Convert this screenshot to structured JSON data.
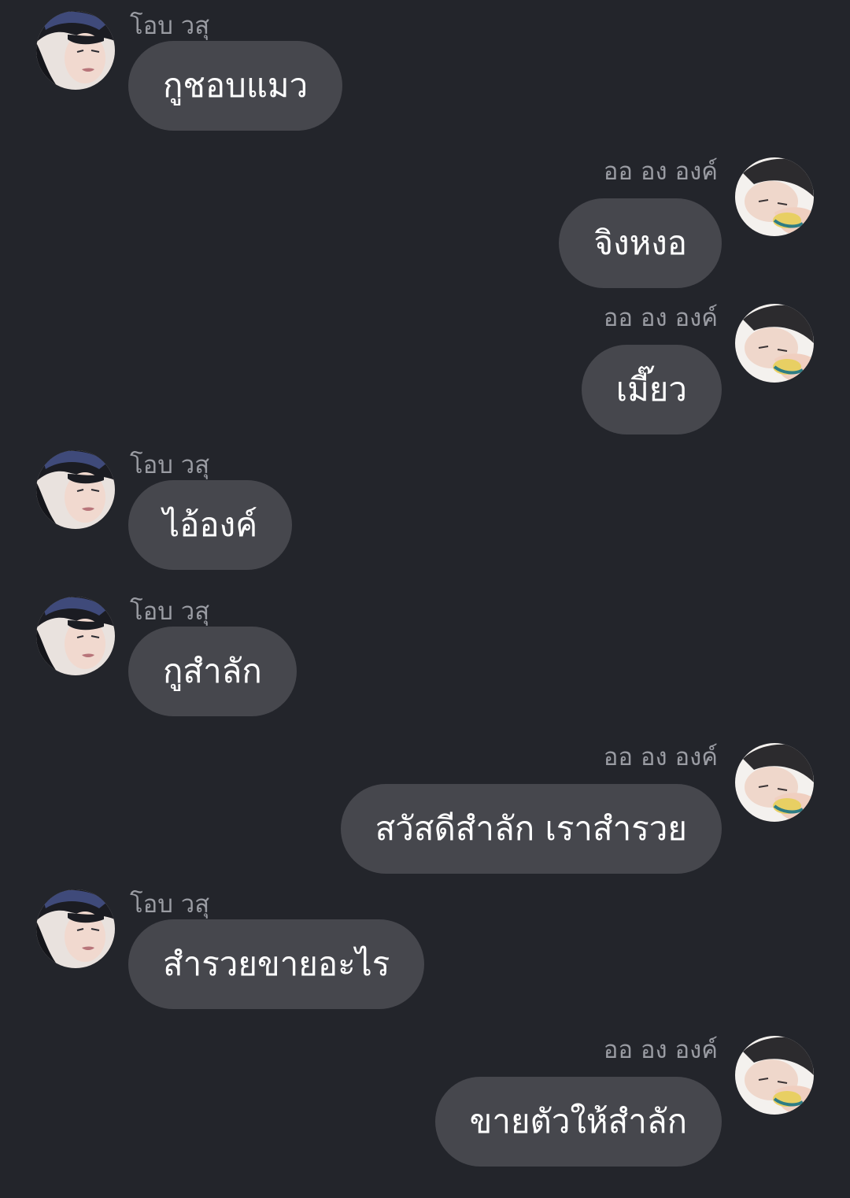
{
  "users": {
    "left": {
      "name": "โอบ วสุ",
      "avatar_icon": "avatar-dark-hair-man-icon"
    },
    "right": {
      "name": "ออ อง องค์",
      "avatar_icon": "avatar-sleeping-man-icon"
    }
  },
  "colors": {
    "background": "#23252b",
    "bubble": "#46474d",
    "bubble_text": "#ffffff",
    "sender_text": "#9a9ca3"
  },
  "messages": [
    {
      "side": "left",
      "sender": "โอบ วสุ",
      "text": "กูชอบแมว"
    },
    {
      "side": "right",
      "sender": "ออ อง องค์",
      "text": "จิงหงอ"
    },
    {
      "side": "right",
      "sender": "ออ อง องค์",
      "text": "เมี๊ยว"
    },
    {
      "side": "left",
      "sender": "โอบ วสุ",
      "text": "ไอ้องค์"
    },
    {
      "side": "left",
      "sender": "โอบ วสุ",
      "text": "กูสำลัก"
    },
    {
      "side": "right",
      "sender": "ออ อง องค์",
      "text": "สวัสดีสำลัก เราสำรวย"
    },
    {
      "side": "left",
      "sender": "โอบ วสุ",
      "text": "สำรวยขายอะไร"
    },
    {
      "side": "right",
      "sender": "ออ อง องค์",
      "text": "ขายตัวให้สำลัก"
    }
  ]
}
